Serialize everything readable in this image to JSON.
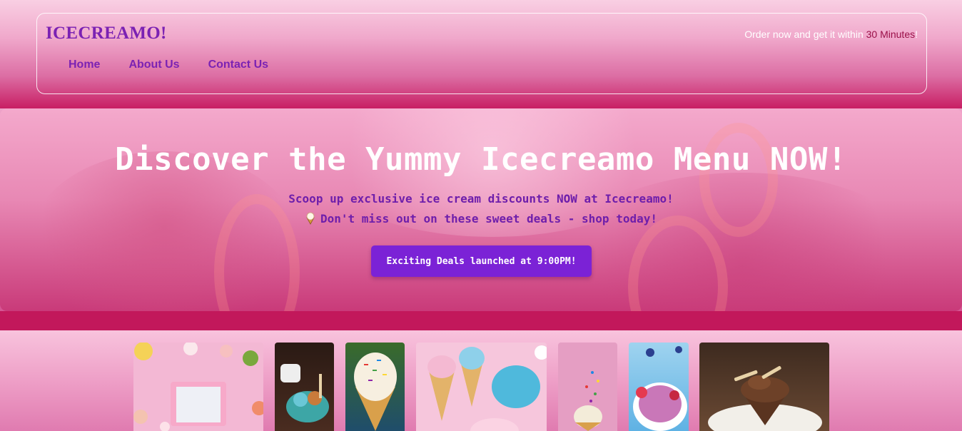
{
  "header": {
    "logo": "ICECREAMO!",
    "promo_prefix": "Order now and get it within ",
    "promo_highlight": "30 Minutes",
    "promo_suffix": "!",
    "nav": [
      {
        "label": "Home"
      },
      {
        "label": "About Us"
      },
      {
        "label": "Contact Us"
      }
    ]
  },
  "hero": {
    "title": "Discover the Yummy Icecreamo Menu NOW!",
    "subtitle_line1": "Scoop up exclusive ice cream discounts NOW at Icecreamo!",
    "subtitle_line2": "Don't miss out on these sweet deals - shop today!",
    "button_label": "Exciting Deals launched at 9:00PM!"
  },
  "gallery": {
    "tiles": [
      {
        "icon": "fruit-frame-photo"
      },
      {
        "icon": "ice-cream-sundae-photo"
      },
      {
        "icon": "sprinkle-cone-photo"
      },
      {
        "icon": "cones-macarons-photo"
      },
      {
        "icon": "sprinkle-cup-photo"
      },
      {
        "icon": "berry-bowl-photo"
      },
      {
        "icon": "chocolate-sundae-photo"
      }
    ]
  },
  "colors": {
    "brand_purple": "#7b22b3",
    "button_purple": "#7b22d6",
    "deep_pink": "#c2185b",
    "promo_accent": "#9a0f48"
  }
}
